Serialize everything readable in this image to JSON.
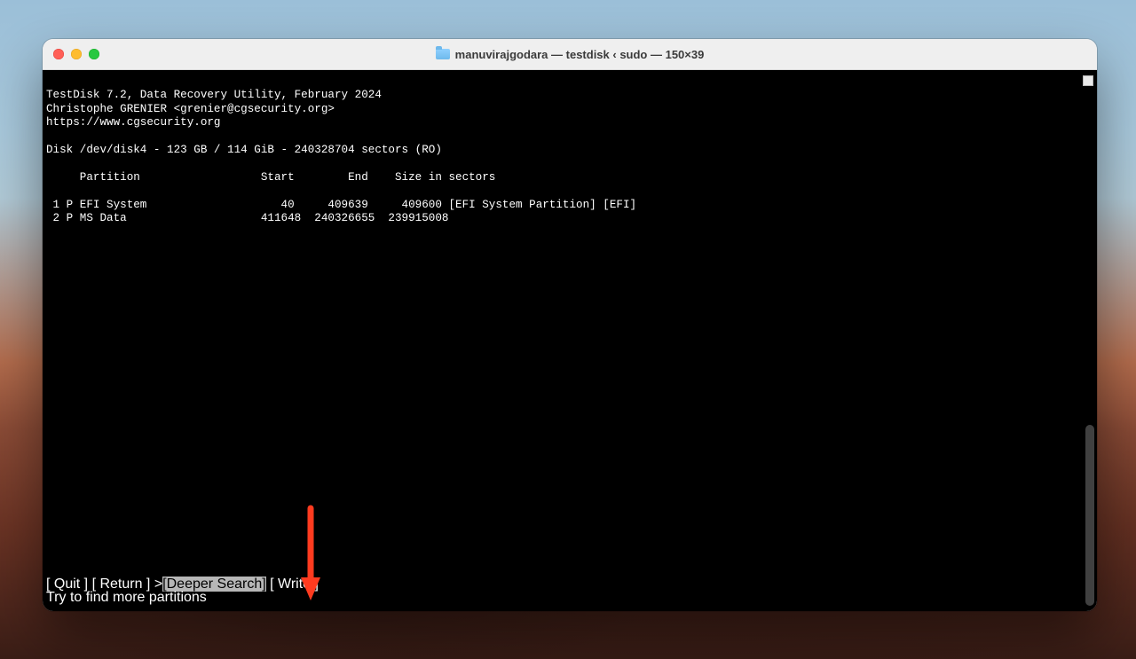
{
  "window": {
    "title": "manuvirajgodara — testdisk ‹ sudo — 150×39"
  },
  "header": {
    "line1": "TestDisk 7.2, Data Recovery Utility, February 2024",
    "line2": "Christophe GRENIER <grenier@cgsecurity.org>",
    "line3": "https://www.cgsecurity.org"
  },
  "disk_line": "Disk /dev/disk4 - 123 GB / 114 GiB - 240328704 sectors (RO)",
  "table": {
    "header": "     Partition                  Start        End    Size in sectors",
    "rows": [
      " 1 P EFI System                    40     409639     409600 [EFI System Partition] [EFI]",
      " 2 P MS Data                    411648  240326655  239915008"
    ]
  },
  "menu": {
    "prefix": "[   Quit  ]  [ Return ] ",
    "cursor": ">",
    "highlighted": "[Deeper Search]",
    "suffix": "  [  Write  ]"
  },
  "helper": "                          Try to find more partitions"
}
